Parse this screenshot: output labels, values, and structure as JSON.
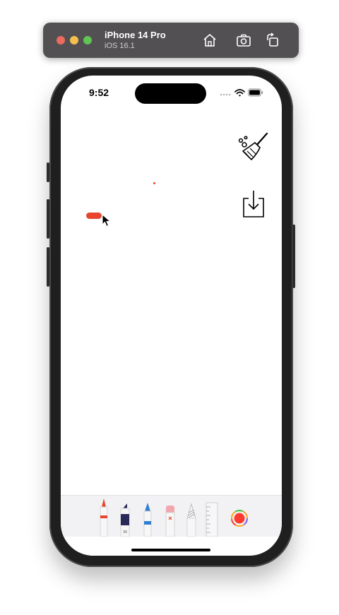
{
  "simulator": {
    "device_name": "iPhone 14 Pro",
    "os_version": "iOS 16.1",
    "toolbar_icons": [
      "home-icon",
      "screenshot-icon",
      "rotate-icon"
    ]
  },
  "status_bar": {
    "time": "9:52",
    "icons": [
      "cellular-dots-icon",
      "wifi-icon",
      "battery-icon"
    ]
  },
  "actions": {
    "clear_icon": "broom-icon",
    "save_icon": "download-icon"
  },
  "canvas": {
    "ink_color": "#e8442e"
  },
  "tool_palette": {
    "tools": [
      "pen-tool",
      "marker-tool",
      "pencil-tool",
      "eraser-tool",
      "lasso-tool",
      "ruler-tool",
      "color-picker"
    ],
    "marker_width_label": "30",
    "selected_color": "#ff3b30"
  }
}
